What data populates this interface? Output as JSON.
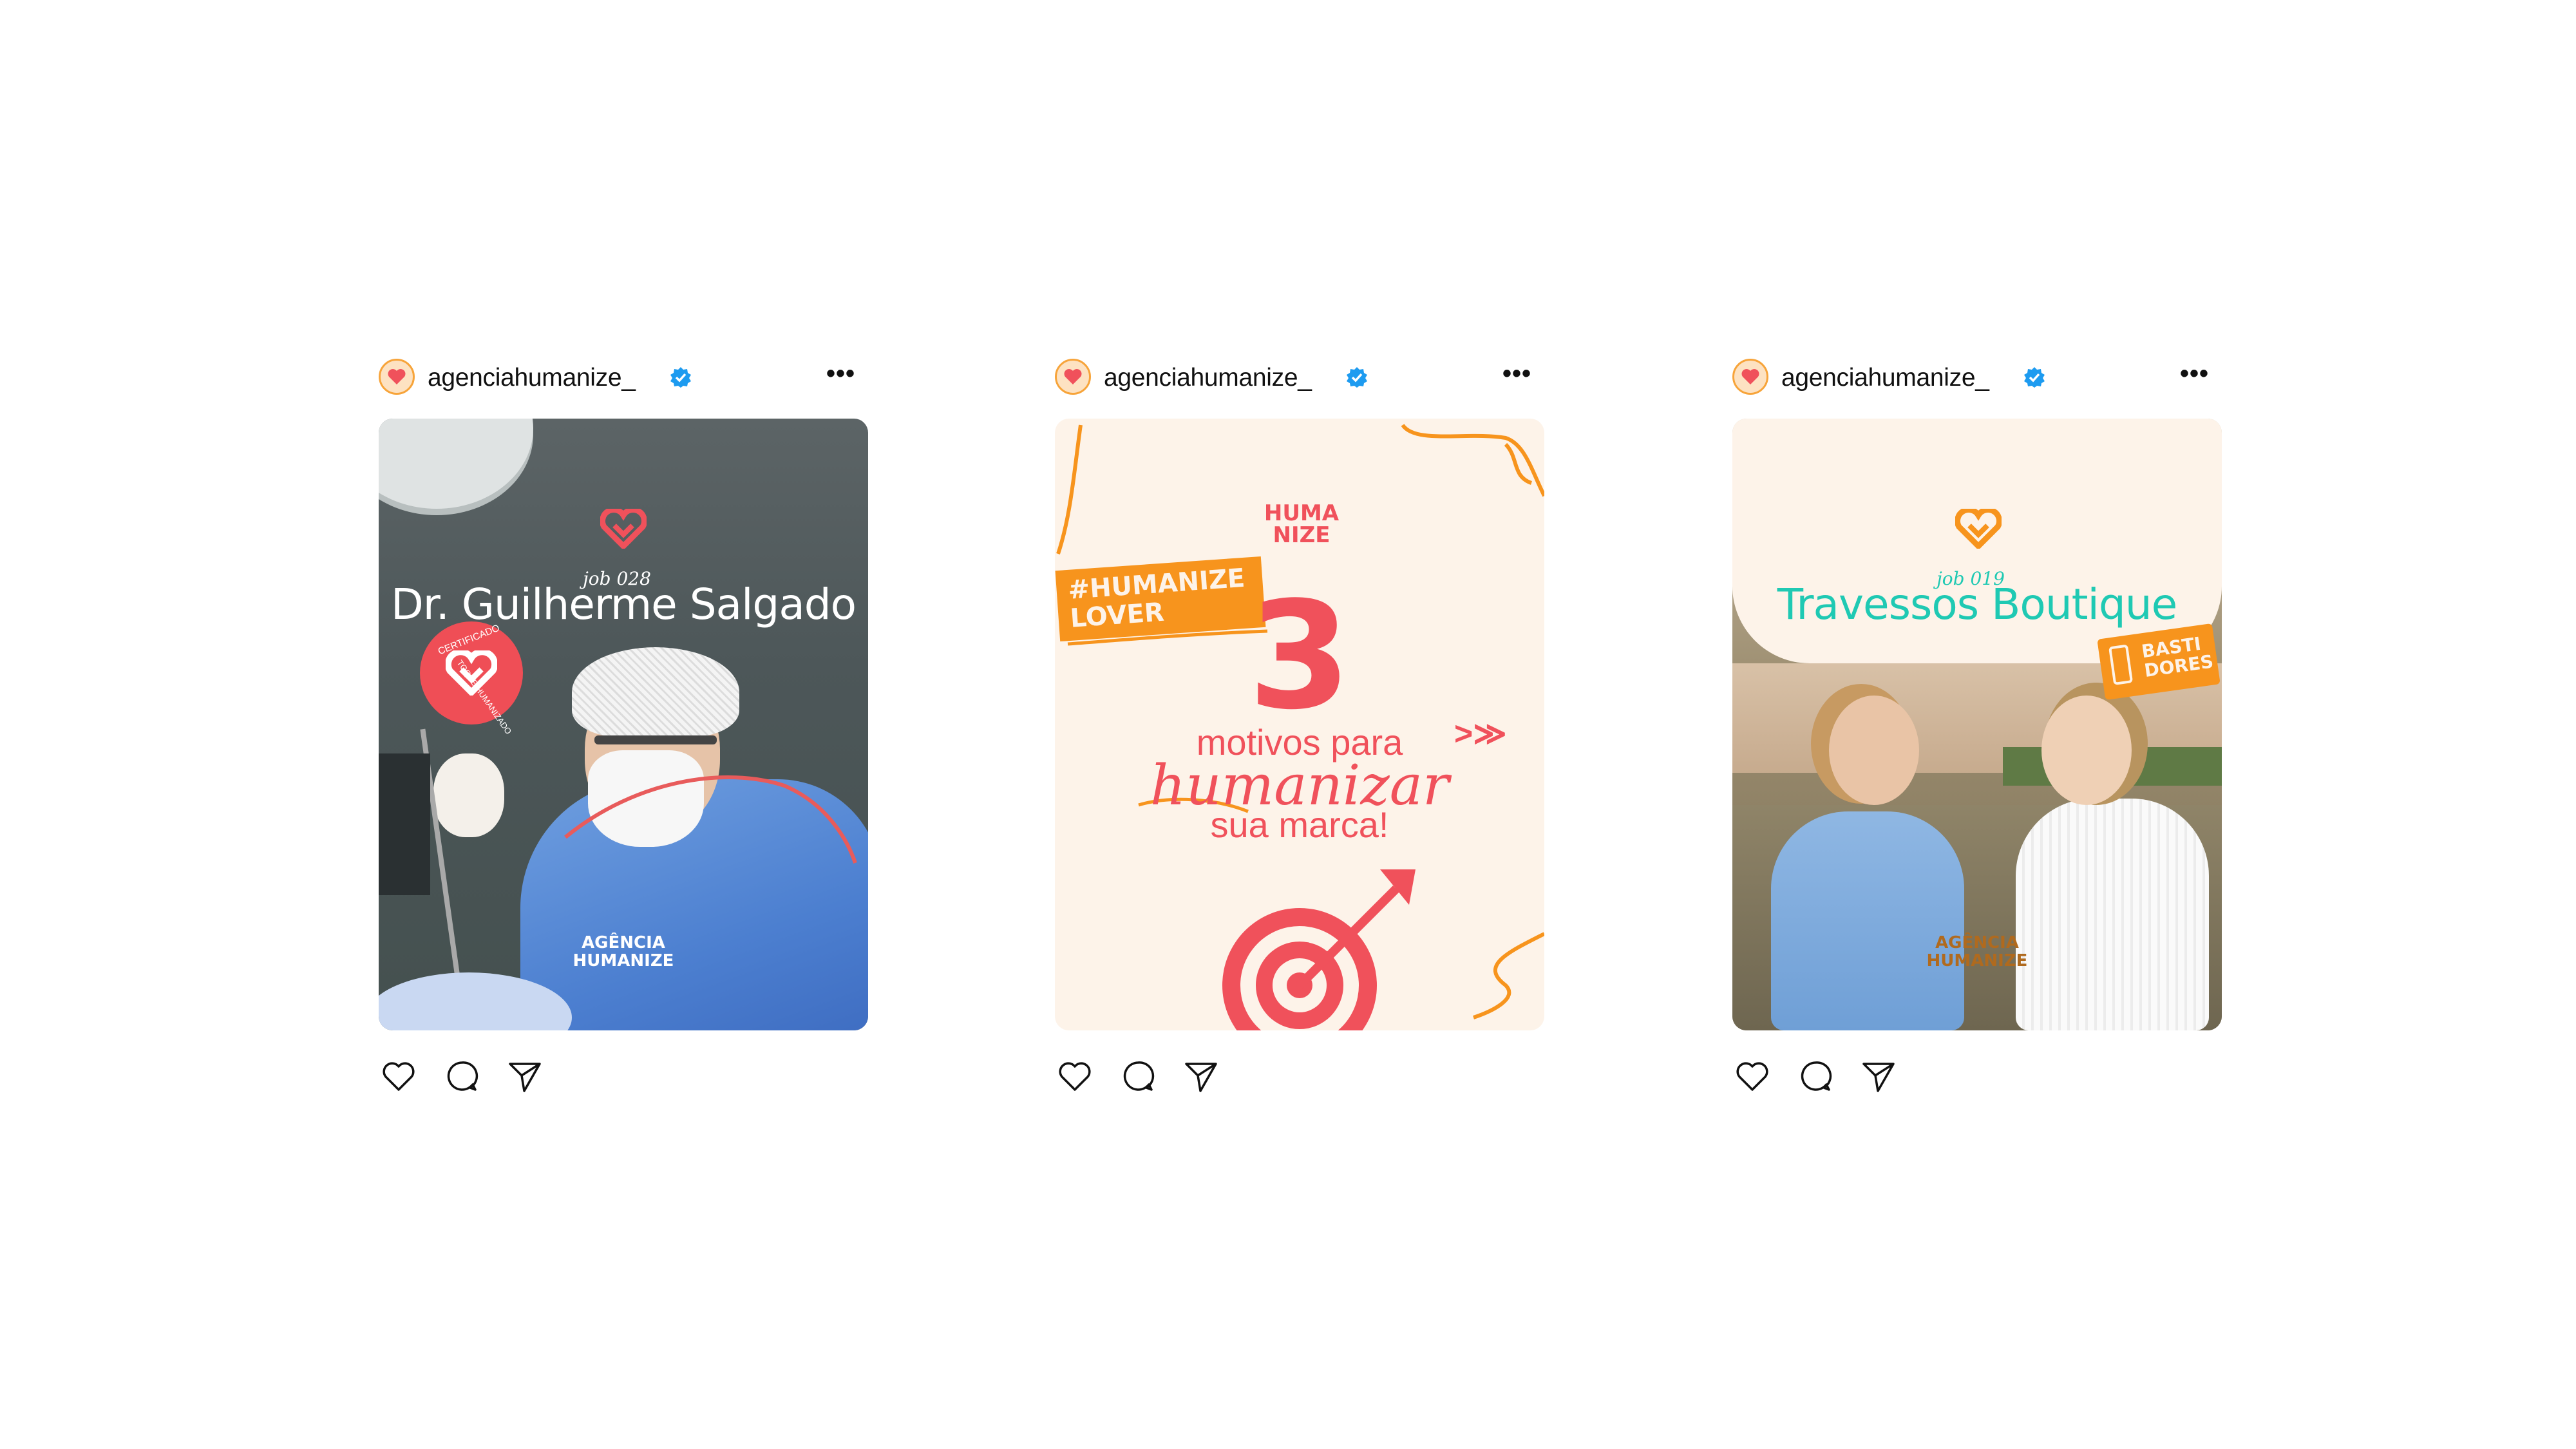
{
  "colors": {
    "brand_red": "#f0515b",
    "brand_orange": "#f7941d",
    "teal": "#1fc9b3",
    "cream": "#fdf3e9"
  },
  "posts": [
    {
      "username": "agenciahumanize_",
      "verified": true,
      "image": {
        "job": "job 028",
        "title": "Dr. Guilherme Salgado",
        "stamp_top": "CERTIFICADO",
        "stamp_bottom": "TOQUE HUMANIZADO",
        "watermark_line1": "AGÊNCIA",
        "watermark_line2": "HUMANIZE"
      }
    },
    {
      "username": "agenciahumanize_",
      "verified": true,
      "image": {
        "logo_line1": "HUMA",
        "logo_line2": "NIZE",
        "tag_line1": "#HUMANIZE",
        "tag_line2": "LOVER",
        "number": "3",
        "line1": "motivos para",
        "line2": "humanizar",
        "line3": "sua marca!",
        "arrows": ">≫"
      }
    },
    {
      "username": "agenciahumanize_",
      "verified": true,
      "image": {
        "job": "job 019",
        "title": "Travessos Boutique",
        "badge_line1": "BASTI",
        "badge_line2": "DORES",
        "watermark_line1": "AGÊNCIA",
        "watermark_line2": "HUMANIZE"
      }
    }
  ],
  "icons": [
    "heart-icon",
    "comment-icon",
    "share-icon",
    "more-options-icon",
    "verified-icon"
  ]
}
